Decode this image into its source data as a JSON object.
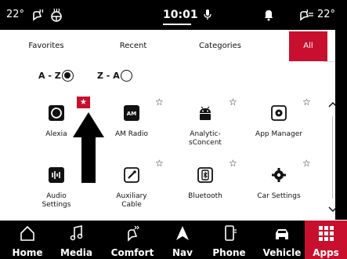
{
  "status_bar": {
    "left_temp": "22°",
    "time": "10:01",
    "right_temp": "22°"
  },
  "tabs": [
    {
      "label": "Favorites",
      "active": false
    },
    {
      "label": "Recent",
      "active": false
    },
    {
      "label": "Categories",
      "active": false
    },
    {
      "label": "All",
      "active": true
    }
  ],
  "sort": {
    "az_label": "A - Z",
    "za_label": "Z - A",
    "selected": "A - Z"
  },
  "apps": [
    {
      "label": "Alexia",
      "icon": "alexa-icon",
      "favorite": true
    },
    {
      "label": "AM Radio",
      "icon": "am-radio-icon",
      "favorite": false,
      "icon_text": "AM"
    },
    {
      "label": "Analytic-\nsConcent",
      "icon": "android-icon",
      "favorite": false
    },
    {
      "label": "App Manager",
      "icon": "app-manager-icon",
      "favorite": false
    },
    {
      "label": "Audio\nSettings",
      "icon": "audio-settings-icon",
      "favorite": false
    },
    {
      "label": "Auxiliary\nCable",
      "icon": "aux-cable-icon",
      "favorite": false
    },
    {
      "label": "Bluetooth",
      "icon": "bluetooth-phone-icon",
      "favorite": false
    },
    {
      "label": "Car Settings",
      "icon": "settings-gear-icon",
      "favorite": false
    }
  ],
  "favorite_badge_glyph": "★",
  "empty_star_glyph": "☆",
  "bottom_nav": [
    {
      "label": "Home",
      "icon": "home-icon",
      "active": false
    },
    {
      "label": "Media",
      "icon": "music-note-icon",
      "active": false
    },
    {
      "label": "Comfort",
      "icon": "climate-seat-icon",
      "active": false
    },
    {
      "label": "Nav",
      "icon": "navigation-arrow-icon",
      "active": false
    },
    {
      "label": "Phone",
      "icon": "phone-icon",
      "active": false
    },
    {
      "label": "Vehicle",
      "icon": "vehicle-icon",
      "active": false
    },
    {
      "label": "Apps",
      "icon": "apps-grid-icon",
      "active": true
    }
  ],
  "colors": {
    "accent": "#c8102e",
    "bar": "#000000"
  }
}
